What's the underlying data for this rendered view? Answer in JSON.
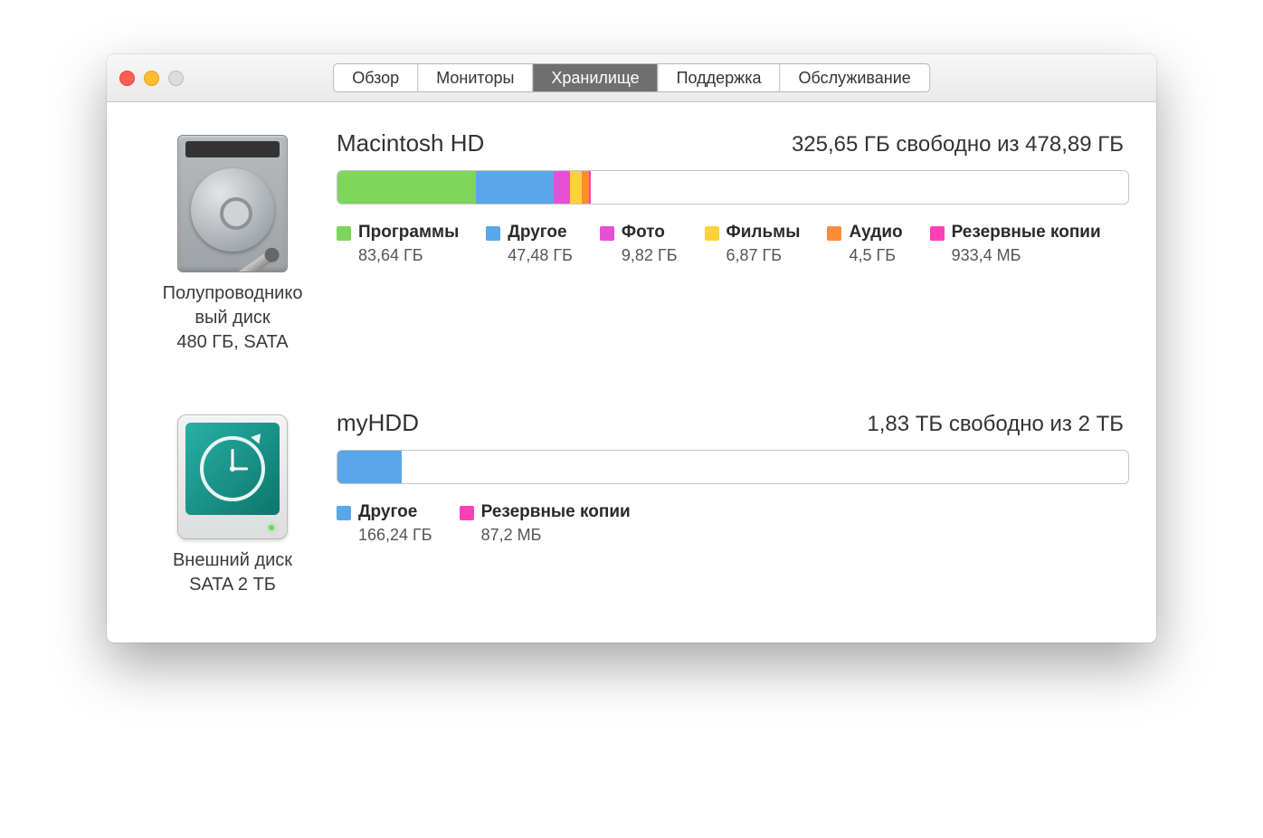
{
  "tabs": [
    "Обзор",
    "Мониторы",
    "Хранилище",
    "Поддержка",
    "Обслуживание"
  ],
  "active_tab_index": 2,
  "colors": {
    "apps": "#7dd65a",
    "other": "#5aa6ea",
    "photos": "#e84fd4",
    "movies": "#ffd23a",
    "audio": "#ff8a3a",
    "backups": "#ff3fb5"
  },
  "disks": [
    {
      "icon": "internal",
      "type_label": "Полупроводнико\nвый диск\n480 ГБ, SATA",
      "name": "Macintosh HD",
      "free_text": "325,65 ГБ свободно из 478,89 ГБ",
      "segments": [
        {
          "key": "apps",
          "pct": 17.5
        },
        {
          "key": "other",
          "pct": 9.9
        },
        {
          "key": "photos",
          "pct": 2.05
        },
        {
          "key": "movies",
          "pct": 1.43
        },
        {
          "key": "audio",
          "pct": 0.94
        },
        {
          "key": "backups",
          "pct": 0.19
        }
      ],
      "legend": [
        {
          "key": "apps",
          "label": "Программы",
          "value": "83,64 ГБ"
        },
        {
          "key": "other",
          "label": "Другое",
          "value": "47,48 ГБ"
        },
        {
          "key": "photos",
          "label": "Фото",
          "value": "9,82 ГБ"
        },
        {
          "key": "movies",
          "label": "Фильмы",
          "value": "6,87 ГБ"
        },
        {
          "key": "audio",
          "label": "Аудио",
          "value": "4,5 ГБ"
        },
        {
          "key": "backups",
          "label": "Резервные копии",
          "value": "933,4 МБ"
        }
      ]
    },
    {
      "icon": "external",
      "type_label": "Внешний диск\nSATA 2 ТБ",
      "name": "myHDD",
      "free_text": "1,83 ТБ свободно из 2 ТБ",
      "segments": [
        {
          "key": "other",
          "pct": 8.1
        },
        {
          "key": "backups",
          "pct": 0.005
        }
      ],
      "legend": [
        {
          "key": "other",
          "label": "Другое",
          "value": "166,24 ГБ"
        },
        {
          "key": "backups",
          "label": "Резервные копии",
          "value": "87,2 МБ"
        }
      ]
    }
  ]
}
